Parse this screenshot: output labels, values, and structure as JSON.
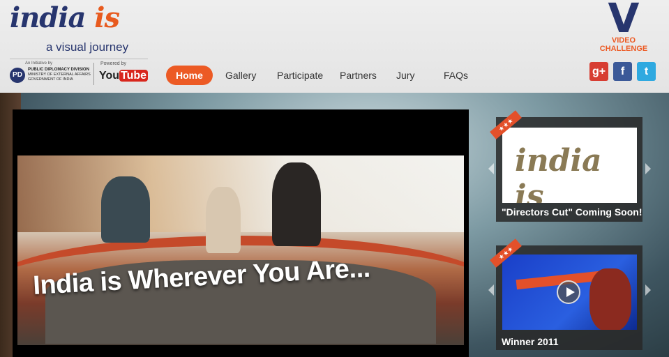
{
  "logo": {
    "title_main": "india",
    "title_is": "is",
    "tagline": "a visual journey",
    "initiative_label": "An Initiative by",
    "pd_abbrev": "PD",
    "pd_line1": "PUBLIC DIPLOMACY DIVISION",
    "pd_line2": "MINISTRY OF EXTERNAL AFFAIRS",
    "pd_line3": "GOVERNMENT OF INDIA",
    "powered_by": "Powered by",
    "youtube_you": "You",
    "youtube_tube": "Tube"
  },
  "nav": {
    "items": [
      {
        "label": "Home"
      },
      {
        "label": "Gallery"
      },
      {
        "label": "Participate"
      },
      {
        "label": "Partners"
      },
      {
        "label": "Jury"
      },
      {
        "label": "FAQs"
      }
    ],
    "active": "Home"
  },
  "badge": {
    "letter": "V",
    "line1": "VIDEO",
    "line2": "CHALLENGE"
  },
  "social": [
    {
      "name": "google-plus-icon",
      "glyph": "g+",
      "color": "#d73d32"
    },
    {
      "name": "facebook-icon",
      "glyph": "f",
      "color": "#3b5998"
    },
    {
      "name": "twitter-icon",
      "glyph": "t",
      "color": "#2fa9e0"
    }
  ],
  "player": {
    "caption": "India is Wherever You Are..."
  },
  "cards": [
    {
      "ribbon": "★★★",
      "image_text": "india is",
      "label": "\"Directors Cut\" Coming Soon!"
    },
    {
      "ribbon": "★★★",
      "label": "Winner 2011"
    }
  ],
  "colors": {
    "accent": "#ec5a24",
    "brand_blue": "#27356e"
  }
}
